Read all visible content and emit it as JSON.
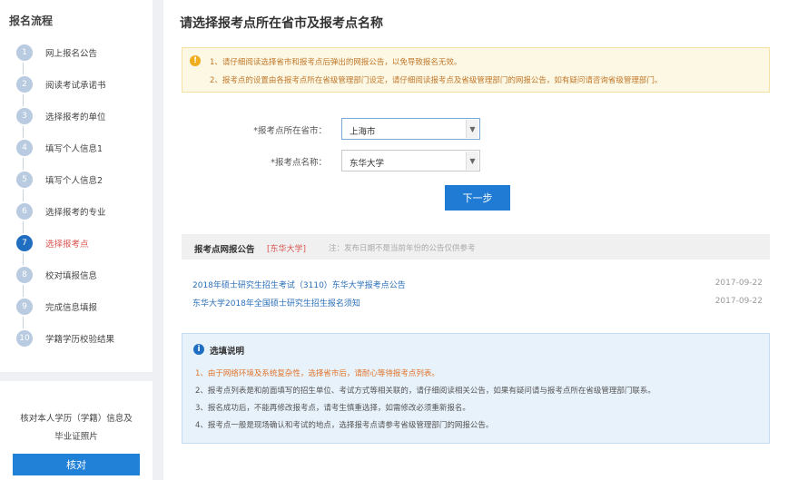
{
  "sidebar": {
    "title": "报名流程",
    "steps": [
      {
        "num": "1",
        "label": "网上报名公告"
      },
      {
        "num": "2",
        "label": "阅读考试承诺书"
      },
      {
        "num": "3",
        "label": "选择报考的单位"
      },
      {
        "num": "4",
        "label": "填写个人信息1"
      },
      {
        "num": "5",
        "label": "填写个人信息2"
      },
      {
        "num": "6",
        "label": "选择报考的专业"
      },
      {
        "num": "7",
        "label": "选择报考点"
      },
      {
        "num": "8",
        "label": "校对填报信息"
      },
      {
        "num": "9",
        "label": "完成信息填报"
      },
      {
        "num": "10",
        "label": "学籍学历校验结果"
      }
    ],
    "active_step": 7,
    "verify_text_1": "核对本人学历（学籍）信息及",
    "verify_text_2": "毕业证照片",
    "verify_button": "核对"
  },
  "main": {
    "title": "请选择报考点所在省市及报考点名称",
    "notice": {
      "icon": "!",
      "lines": [
        "1、请仔细阅读选择省市和报考点后弹出的网报公告，以免导致报名无效。",
        "2、报考点的设置由各报考点所在省级管理部门设定，请仔细阅读报考点及省级管理部门的网报公告，如有疑问请咨询省级管理部门。"
      ]
    },
    "form": {
      "province_label": "*报考点所在省市：",
      "province_value": "上海市",
      "site_label": "*报考点名称：",
      "site_value": "东华大学",
      "next_button": "下一步"
    },
    "announcements": {
      "title": "报考点网报公告",
      "tag": "[东华大学]",
      "note": "注：发布日期不是当前年份的公告仅供参考",
      "items": [
        {
          "title": "2018年硕士研究生招生考试（3110）东华大学报考点公告",
          "date": "2017-09-22"
        },
        {
          "title": "东华大学2018年全国硕士研究生招生报名须知",
          "date": "2017-09-22"
        }
      ]
    },
    "info": {
      "icon": "i",
      "title": "选填说明",
      "lines": [
        "1、由于网络环境及系统复杂性，选择省市后，请耐心等待报考点列表。",
        "2、报考点列表是和前面填写的招生单位、考试方式等相关联的，请仔细阅读相关公告，如果有疑问请与报考点所在省级管理部门联系。",
        "3、报名成功后，不能再修改报考点，请考生慎重选择，如需修改必须重新报名。",
        "4、报考点一般是现场确认和考试的地点，选择报考点请参考省级管理部门的网报公告。"
      ]
    }
  }
}
